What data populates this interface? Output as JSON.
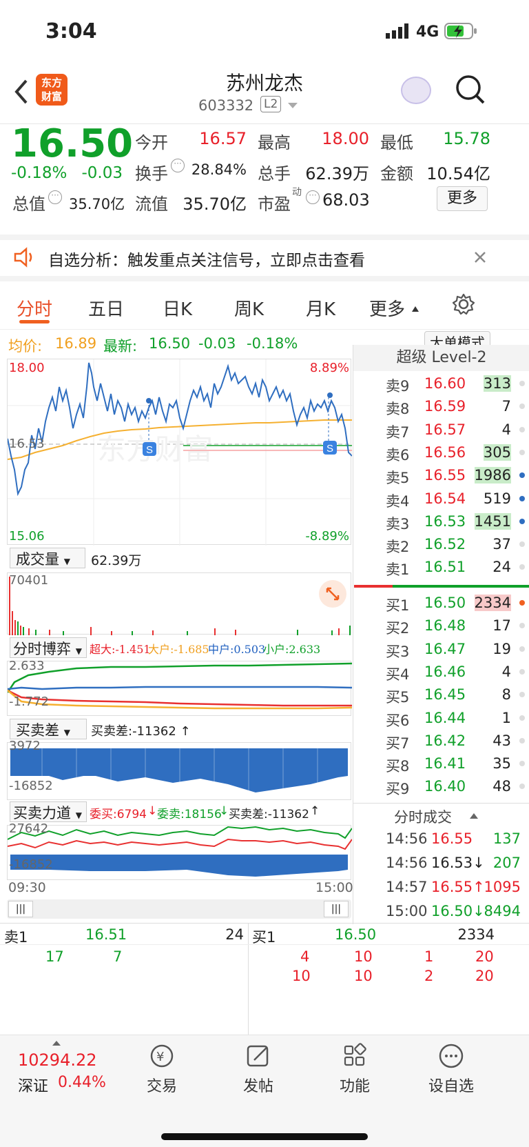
{
  "status": {
    "time": "3:04",
    "network": "4G"
  },
  "header": {
    "logo_line1": "东方",
    "logo_line2": "财富",
    "name": "苏州龙杰",
    "code": "603332",
    "badge": "L2"
  },
  "quote": {
    "price": "16.50",
    "pct": "-0.18%",
    "chg": "-0.03",
    "open_label": "今开",
    "open": "16.57",
    "high_label": "最高",
    "high": "18.00",
    "low_label": "最低",
    "low": "15.78",
    "turnover_label": "换手",
    "turnover": "28.84%",
    "vol_label": "总手",
    "vol": "62.39万",
    "amt_label": "金额",
    "amt": "10.54亿",
    "mcap_label": "总值",
    "mcap": "35.70亿",
    "float_label": "流值",
    "float": "35.70亿",
    "pe_label": "市盈",
    "pe_sup": "动",
    "pe": "68.03",
    "more": "更多"
  },
  "alert": {
    "text": "自选分析：触发重点关注信号，立即点击查看"
  },
  "tabs": [
    "分时",
    "五日",
    "日K",
    "周K",
    "月K",
    "更多"
  ],
  "legend": {
    "avg_label": "均价:",
    "avg": "16.89",
    "last_label": "最新:",
    "last": "16.50",
    "chg": "-0.03",
    "pct": "-0.18%",
    "mode_btn": "大单模式"
  },
  "chart_labels": {
    "ymax": "18.00",
    "ymid": "16.53",
    "ymin": "15.06",
    "pmax": "8.89%",
    "pmin": "-8.89%",
    "watermark": "东方财富",
    "time_start": "09:30",
    "time_end": "15:00"
  },
  "volume": {
    "selector": "成交量",
    "total": "62.39万",
    "max": "70401"
  },
  "game": {
    "selector": "分时博弈",
    "super": "超大:-1.451",
    "big": "大户:-1.685",
    "mid": "中户:0.503",
    "small": "小户:2.633",
    "top": "2.633",
    "bottom": "-1.772"
  },
  "diff": {
    "selector": "买卖差",
    "text": "买卖差:-11362 ↑",
    "top": "3972",
    "bottom": "-16852"
  },
  "force": {
    "selector": "买卖力道",
    "wb": "委买:6794",
    "wb_arrow": "↓",
    "ws": "委卖:18156",
    "ws_arrow": "↓",
    "diff": "买卖差:-11362",
    "diff_arrow": "↑",
    "top": "27642",
    "bottom": "-16852"
  },
  "orderbook": {
    "title": "超级 Level-2",
    "asks": [
      {
        "l": "卖9",
        "p": "16.60",
        "v": "313"
      },
      {
        "l": "卖8",
        "p": "16.59",
        "v": "7"
      },
      {
        "l": "卖7",
        "p": "16.57",
        "v": "4"
      },
      {
        "l": "卖6",
        "p": "16.56",
        "v": "305"
      },
      {
        "l": "卖5",
        "p": "16.55",
        "v": "1986"
      },
      {
        "l": "卖4",
        "p": "16.54",
        "v": "519"
      },
      {
        "l": "卖3",
        "p": "16.53",
        "v": "1451"
      },
      {
        "l": "卖2",
        "p": "16.52",
        "v": "37"
      },
      {
        "l": "卖1",
        "p": "16.51",
        "v": "24"
      }
    ],
    "bids": [
      {
        "l": "买1",
        "p": "16.50",
        "v": "2334"
      },
      {
        "l": "买2",
        "p": "16.48",
        "v": "17"
      },
      {
        "l": "买3",
        "p": "16.47",
        "v": "19"
      },
      {
        "l": "买4",
        "p": "16.46",
        "v": "4"
      },
      {
        "l": "买5",
        "p": "16.45",
        "v": "8"
      },
      {
        "l": "买6",
        "p": "16.44",
        "v": "1"
      },
      {
        "l": "买7",
        "p": "16.42",
        "v": "43"
      },
      {
        "l": "买8",
        "p": "16.41",
        "v": "35"
      },
      {
        "l": "买9",
        "p": "16.40",
        "v": "48"
      }
    ]
  },
  "ticks": {
    "title": "分时成交",
    "rows": [
      {
        "t": "14:56",
        "p": "16.55",
        "v": "137"
      },
      {
        "t": "14:56",
        "p": "16.53↓",
        "v": "207"
      },
      {
        "t": "14:57",
        "p": "16.55↑",
        "v": "1095"
      },
      {
        "t": "15:00",
        "p": "16.50↓",
        "v": "8494"
      }
    ]
  },
  "queue": {
    "ask_label": "卖1",
    "ask_price": "16.51",
    "ask_vol": "24",
    "bid_label": "买1",
    "bid_price": "16.50",
    "bid_vol": "2334",
    "ask_q": [
      "17",
      "7"
    ],
    "bid_q": [
      "4",
      "10",
      "1",
      "20"
    ],
    "bid_q2": [
      "10",
      "10",
      "2",
      "20"
    ]
  },
  "nav": {
    "index_val": "10294.22",
    "index_name": "深证",
    "index_pct": "0.44%",
    "items": [
      "交易",
      "发帖",
      "功能",
      "设自选"
    ]
  }
}
